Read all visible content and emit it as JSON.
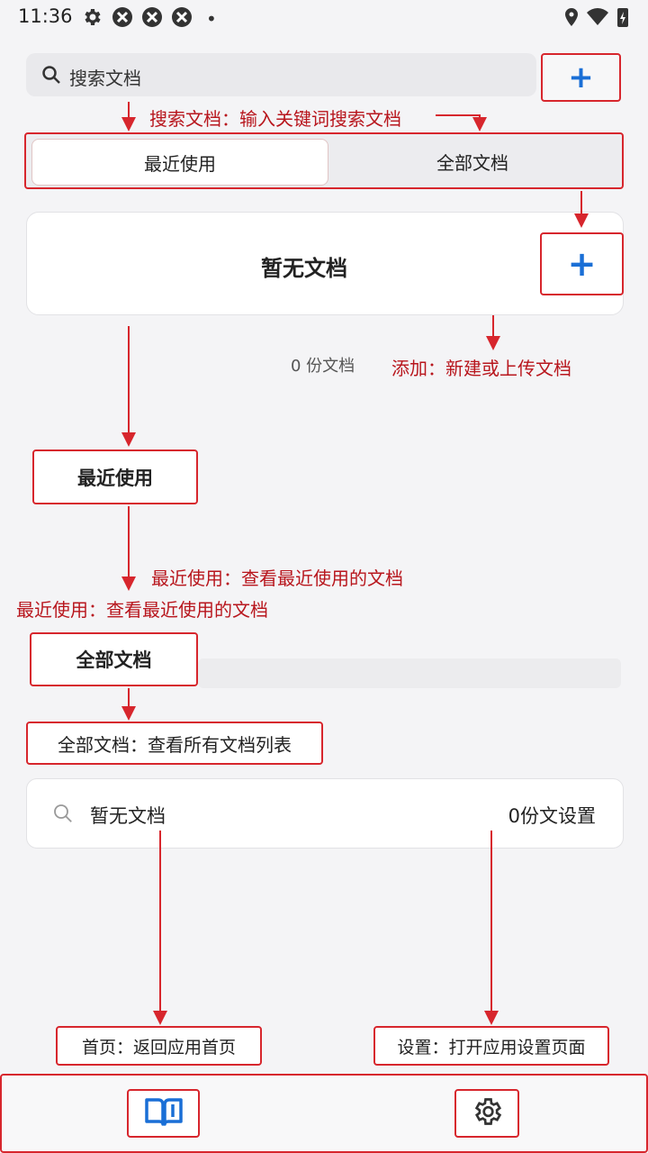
{
  "status_bar": {
    "time": "11:36",
    "icons": [
      "gear-icon",
      "app-icon",
      "app-icon",
      "app-icon",
      "location-icon",
      "wifi-icon",
      "battery-charging-icon"
    ]
  },
  "search": {
    "placeholder": "搜索文档",
    "add_symbol": "+"
  },
  "tabs": [
    {
      "label": "最近使用",
      "active": true
    },
    {
      "label": "全部文档",
      "active": false
    }
  ],
  "empty_card": {
    "title": "暂无文档",
    "add_symbol": "+"
  },
  "count_text": "0 份文档",
  "sections": {
    "recent_label": "最近使用",
    "all_label": "全部文档"
  },
  "list_card": {
    "text": "暂无文档",
    "right_text": "0份文设置"
  },
  "annotations": {
    "search": "搜索文档：输入关键词搜索文档",
    "add": "添加：新建或上传文档",
    "recent_1": "最近使用：查看最近使用的文档",
    "recent_2": "最近使用：查看最近使用的文档",
    "all": "全部文档：查看所有文档列表",
    "home": "首页：返回应用首页",
    "settings": "设置：打开应用设置页面"
  },
  "colors": {
    "annotation_red": "#d7262d",
    "accent_blue": "#1a6fd6"
  }
}
